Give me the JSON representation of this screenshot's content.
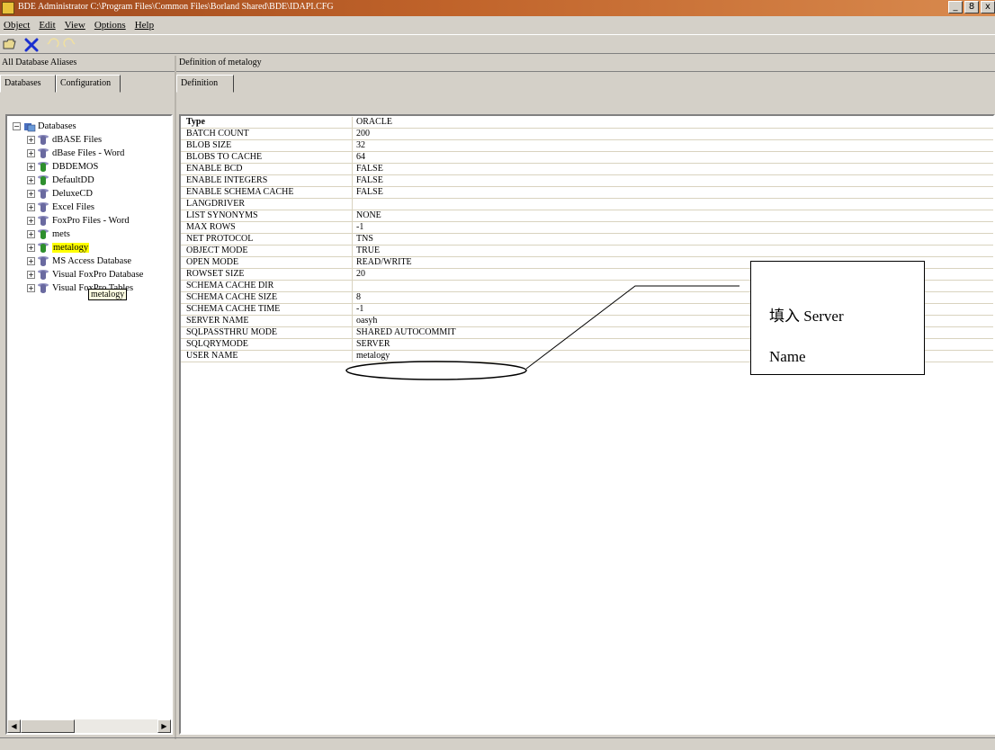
{
  "window": {
    "title": "BDE Administrator C:\\Program Files\\Common Files\\Borland Shared\\BDE\\IDAPI.CFG",
    "controls": [
      "_",
      "8",
      "x"
    ]
  },
  "menu": [
    "Object",
    "Edit",
    "View",
    "Options",
    "Help"
  ],
  "toolbar": {
    "icons": [
      "open-icon",
      "delete-icon",
      "undo-icon",
      "redo-icon"
    ]
  },
  "left_pane": {
    "header": "All Database Aliases",
    "tabs": [
      "Databases",
      "Configuration"
    ],
    "tree": {
      "root": "Databases",
      "items": [
        {
          "label": "dBASE Files",
          "icon_color": "blue"
        },
        {
          "label": "dBase Files - Word",
          "icon_color": "blue"
        },
        {
          "label": "DBDEMOS",
          "icon_color": "green"
        },
        {
          "label": "DefaultDD",
          "icon_color": "green"
        },
        {
          "label": "DeluxeCD",
          "icon_color": "blue"
        },
        {
          "label": "Excel Files",
          "icon_color": "blue"
        },
        {
          "label": "FoxPro Files - Word",
          "icon_color": "blue"
        },
        {
          "label": "mets",
          "icon_color": "green"
        },
        {
          "label": "metalogy",
          "icon_color": "green",
          "selected": true
        },
        {
          "label": "MS Access Database",
          "icon_color": "blue"
        },
        {
          "label": "Visual FoxPro Database",
          "icon_color": "blue"
        },
        {
          "label": "Visual FoxPro Tables",
          "icon_color": "blue"
        }
      ],
      "tooltip": "metalogy"
    }
  },
  "right_pane": {
    "header": "Definition of metalogy",
    "tab": "Definition",
    "rows": [
      {
        "key": "Type",
        "value": "ORACLE",
        "bold": true
      },
      {
        "key": "BATCH COUNT",
        "value": "200"
      },
      {
        "key": "BLOB SIZE",
        "value": "32"
      },
      {
        "key": "BLOBS TO CACHE",
        "value": "64"
      },
      {
        "key": "ENABLE BCD",
        "value": "FALSE"
      },
      {
        "key": "ENABLE INTEGERS",
        "value": "FALSE"
      },
      {
        "key": "ENABLE SCHEMA CACHE",
        "value": "FALSE"
      },
      {
        "key": "LANGDRIVER",
        "value": ""
      },
      {
        "key": "LIST SYNONYMS",
        "value": "NONE"
      },
      {
        "key": "MAX ROWS",
        "value": "-1"
      },
      {
        "key": "NET PROTOCOL",
        "value": "TNS"
      },
      {
        "key": "OBJECT MODE",
        "value": "TRUE"
      },
      {
        "key": "OPEN MODE",
        "value": "READ/WRITE"
      },
      {
        "key": "ROWSET SIZE",
        "value": "20"
      },
      {
        "key": "SCHEMA CACHE DIR",
        "value": ""
      },
      {
        "key": "SCHEMA CACHE SIZE",
        "value": "8"
      },
      {
        "key": "SCHEMA CACHE TIME",
        "value": "-1"
      },
      {
        "key": "SERVER NAME",
        "value": "oasyh"
      },
      {
        "key": "SQLPASSTHRU MODE",
        "value": "SHARED AUTOCOMMIT"
      },
      {
        "key": "SQLQRYMODE",
        "value": "SERVER"
      },
      {
        "key": "USER NAME",
        "value": "metalogy"
      }
    ]
  },
  "callout": {
    "line1": "填入 Server",
    "line2": "Name"
  }
}
